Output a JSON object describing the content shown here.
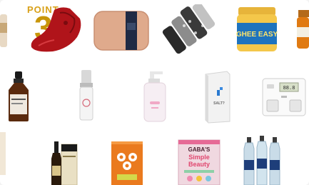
{
  "promo": {
    "point_label": "POINT",
    "point_number": "3"
  },
  "products": [
    {
      "name": "massage-pillow-red"
    },
    {
      "name": "body-pillow-beige"
    },
    {
      "name": "hair-curlers"
    },
    {
      "name": "ghee-easy-jar",
      "label": "GHEE EASY"
    },
    {
      "name": "amber-jar-partial"
    },
    {
      "name": "amber-dropper-bottle"
    },
    {
      "name": "serum-pump-bottle"
    },
    {
      "name": "pink-pump-bottle"
    },
    {
      "name": "white-box-product",
      "label": "SALT?"
    },
    {
      "name": "body-composition-scale"
    },
    {
      "name": "wine-bottle-with-box"
    },
    {
      "name": "orange-snack-pouch"
    },
    {
      "name": "simple-beauty-pouch",
      "brand": "GABA'S",
      "label_line1": "Simple",
      "label_line2": "Beauty"
    },
    {
      "name": "water-bottles-pack"
    }
  ]
}
